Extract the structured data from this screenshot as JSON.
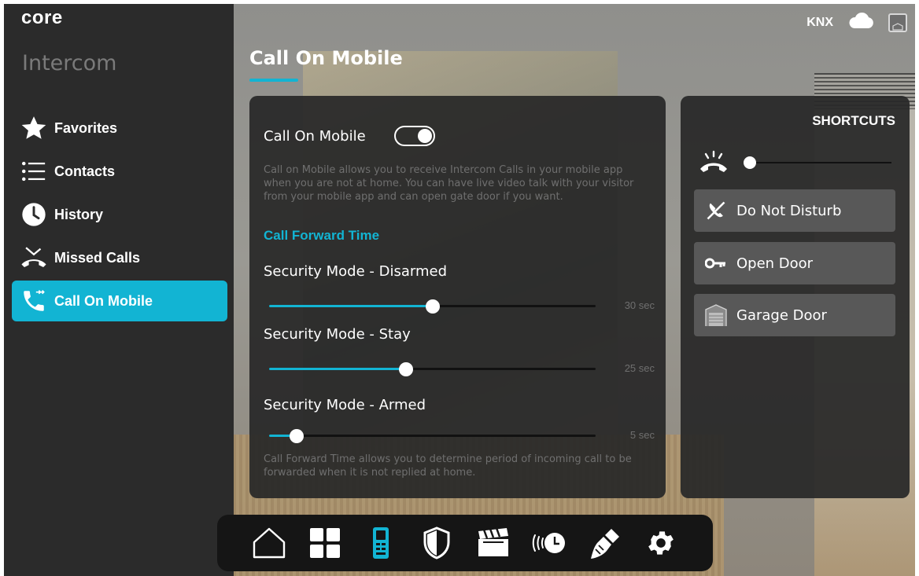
{
  "app": {
    "logo": "core",
    "section_title": "Intercom"
  },
  "status": {
    "knx": "KNX"
  },
  "sidebar": {
    "items": [
      {
        "label": "Favorites",
        "icon": "star-icon"
      },
      {
        "label": "Contacts",
        "icon": "list-icon"
      },
      {
        "label": "History",
        "icon": "clock-icon"
      },
      {
        "label": "Missed Calls",
        "icon": "missed-call-icon"
      },
      {
        "label": "Call On Mobile",
        "icon": "phone-forward-icon",
        "active": true
      }
    ]
  },
  "page": {
    "title": "Call On Mobile"
  },
  "call_on_mobile": {
    "toggle_label": "Call On Mobile",
    "enabled": true,
    "description": "Call on Mobile allows you to receive Intercom Calls in your mobile app when you are not at home. You can have live video talk with your visitor from your mobile app and can open gate door if you want.",
    "forward_title": "Call Forward Time",
    "modes": [
      {
        "label": "Security Mode - Disarmed",
        "value": "30 sec",
        "fraction": 0.5
      },
      {
        "label": "Security Mode - Stay",
        "value": "25 sec",
        "fraction": 0.42
      },
      {
        "label": "Security Mode - Armed",
        "value": "5 sec",
        "fraction": 0.085
      }
    ],
    "forward_description": "Call Forward Time allows you to determine period of incoming call to be forwarded when it is not replied at home."
  },
  "shortcuts": {
    "title": "SHORTCUTS",
    "ring_volume": 0.0,
    "buttons": [
      {
        "label": "Do Not Disturb",
        "icon": "do-not-disturb-icon"
      },
      {
        "label": "Open Door",
        "icon": "key-icon"
      },
      {
        "label": "Garage Door",
        "icon": "garage-icon"
      }
    ]
  },
  "dock": {
    "items": [
      "home-icon",
      "dashboard-grid-icon",
      "intercom-icon",
      "security-shield-icon",
      "scenes-clapper-icon",
      "timer-icon",
      "cleaning-brush-icon",
      "settings-gear-icon"
    ]
  },
  "colors": {
    "accent": "#12b4d3",
    "sidebar": "#2b2b2b",
    "panel": "#282828"
  }
}
